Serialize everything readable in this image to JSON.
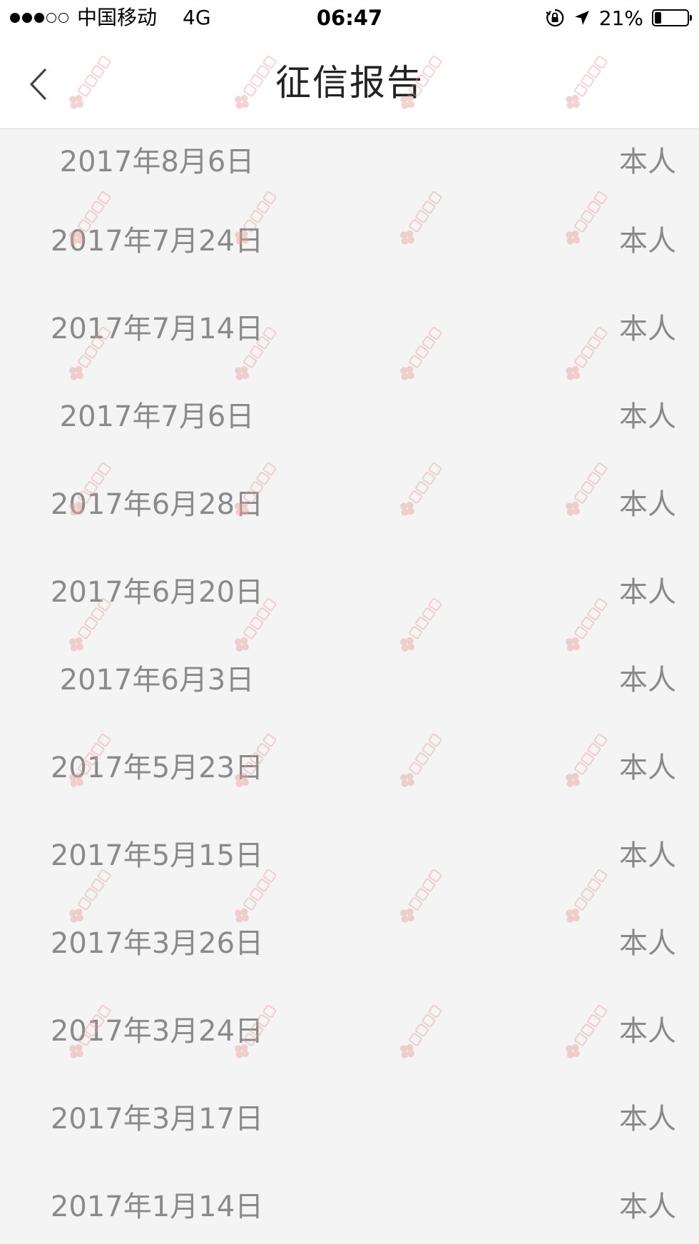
{
  "status_bar": {
    "signal_dots": [
      true,
      true,
      true,
      false,
      false
    ],
    "carrier": "中国移动",
    "network": "4G",
    "time": "06:47",
    "battery_percent": "21%",
    "battery_level": 0.21,
    "icons": [
      "orientation-lock-icon",
      "location-arrow-icon",
      "battery-icon"
    ]
  },
  "header": {
    "title": "征信报告",
    "back_icon": "chevron-left-icon"
  },
  "reports": [
    {
      "date": "2017年8月6日",
      "relation": "本人"
    },
    {
      "date": "2017年7月24日",
      "relation": "本人"
    },
    {
      "date": "2017年7月14日",
      "relation": "本人"
    },
    {
      "date": "2017年7月6日",
      "relation": "本人"
    },
    {
      "date": "2017年6月28日",
      "relation": "本人"
    },
    {
      "date": "2017年6月20日",
      "relation": "本人"
    },
    {
      "date": "2017年6月3日",
      "relation": "本人"
    },
    {
      "date": "2017年5月23日",
      "relation": "本人"
    },
    {
      "date": "2017年5月15日",
      "relation": "本人"
    },
    {
      "date": "2017年3月26日",
      "relation": "本人"
    },
    {
      "date": "2017年3月24日",
      "relation": "本人"
    },
    {
      "date": "2017年3月17日",
      "relation": "本人"
    },
    {
      "date": "2017年1月14日",
      "relation": "本人"
    }
  ],
  "colors": {
    "list_background": "#f4f4f4",
    "header_background": "#ffffff",
    "row_text": "#8a8a8a",
    "title_text": "#222222",
    "watermark": "#e8a0a0"
  },
  "watermark_text": "卡农社区"
}
